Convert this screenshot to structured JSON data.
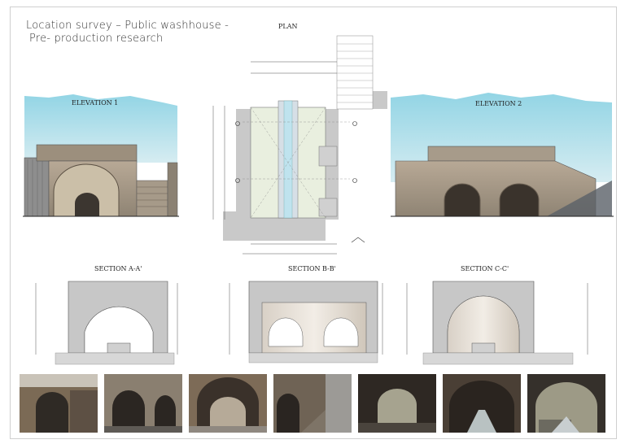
{
  "sheet": {
    "title_line1": "Location survey – Public washhouse -",
    "title_line2": "Pre- production research"
  },
  "drawings": {
    "plan": "PLAN",
    "elevation1": "ELEVATION 1",
    "elevation2": "ELEVATION 2",
    "section_aa": "SECTION A-A'",
    "section_bb": "SECTION B-B'",
    "section_cc": "SECTION C-C'"
  },
  "photos": [
    {
      "name": "photo-exterior-arch"
    },
    {
      "name": "photo-double-arch"
    },
    {
      "name": "photo-interior-vault"
    },
    {
      "name": "photo-arch-and-stairs"
    },
    {
      "name": "photo-inside-looking-out"
    },
    {
      "name": "photo-wash-trough"
    },
    {
      "name": "photo-arched-opening"
    }
  ],
  "colors": {
    "wall_grey": "#c8c8c8",
    "stone": "#a89c8c",
    "sky": "#8fd0dc",
    "water": "#bfe3ee",
    "plan_floor": "#e9efdf"
  }
}
